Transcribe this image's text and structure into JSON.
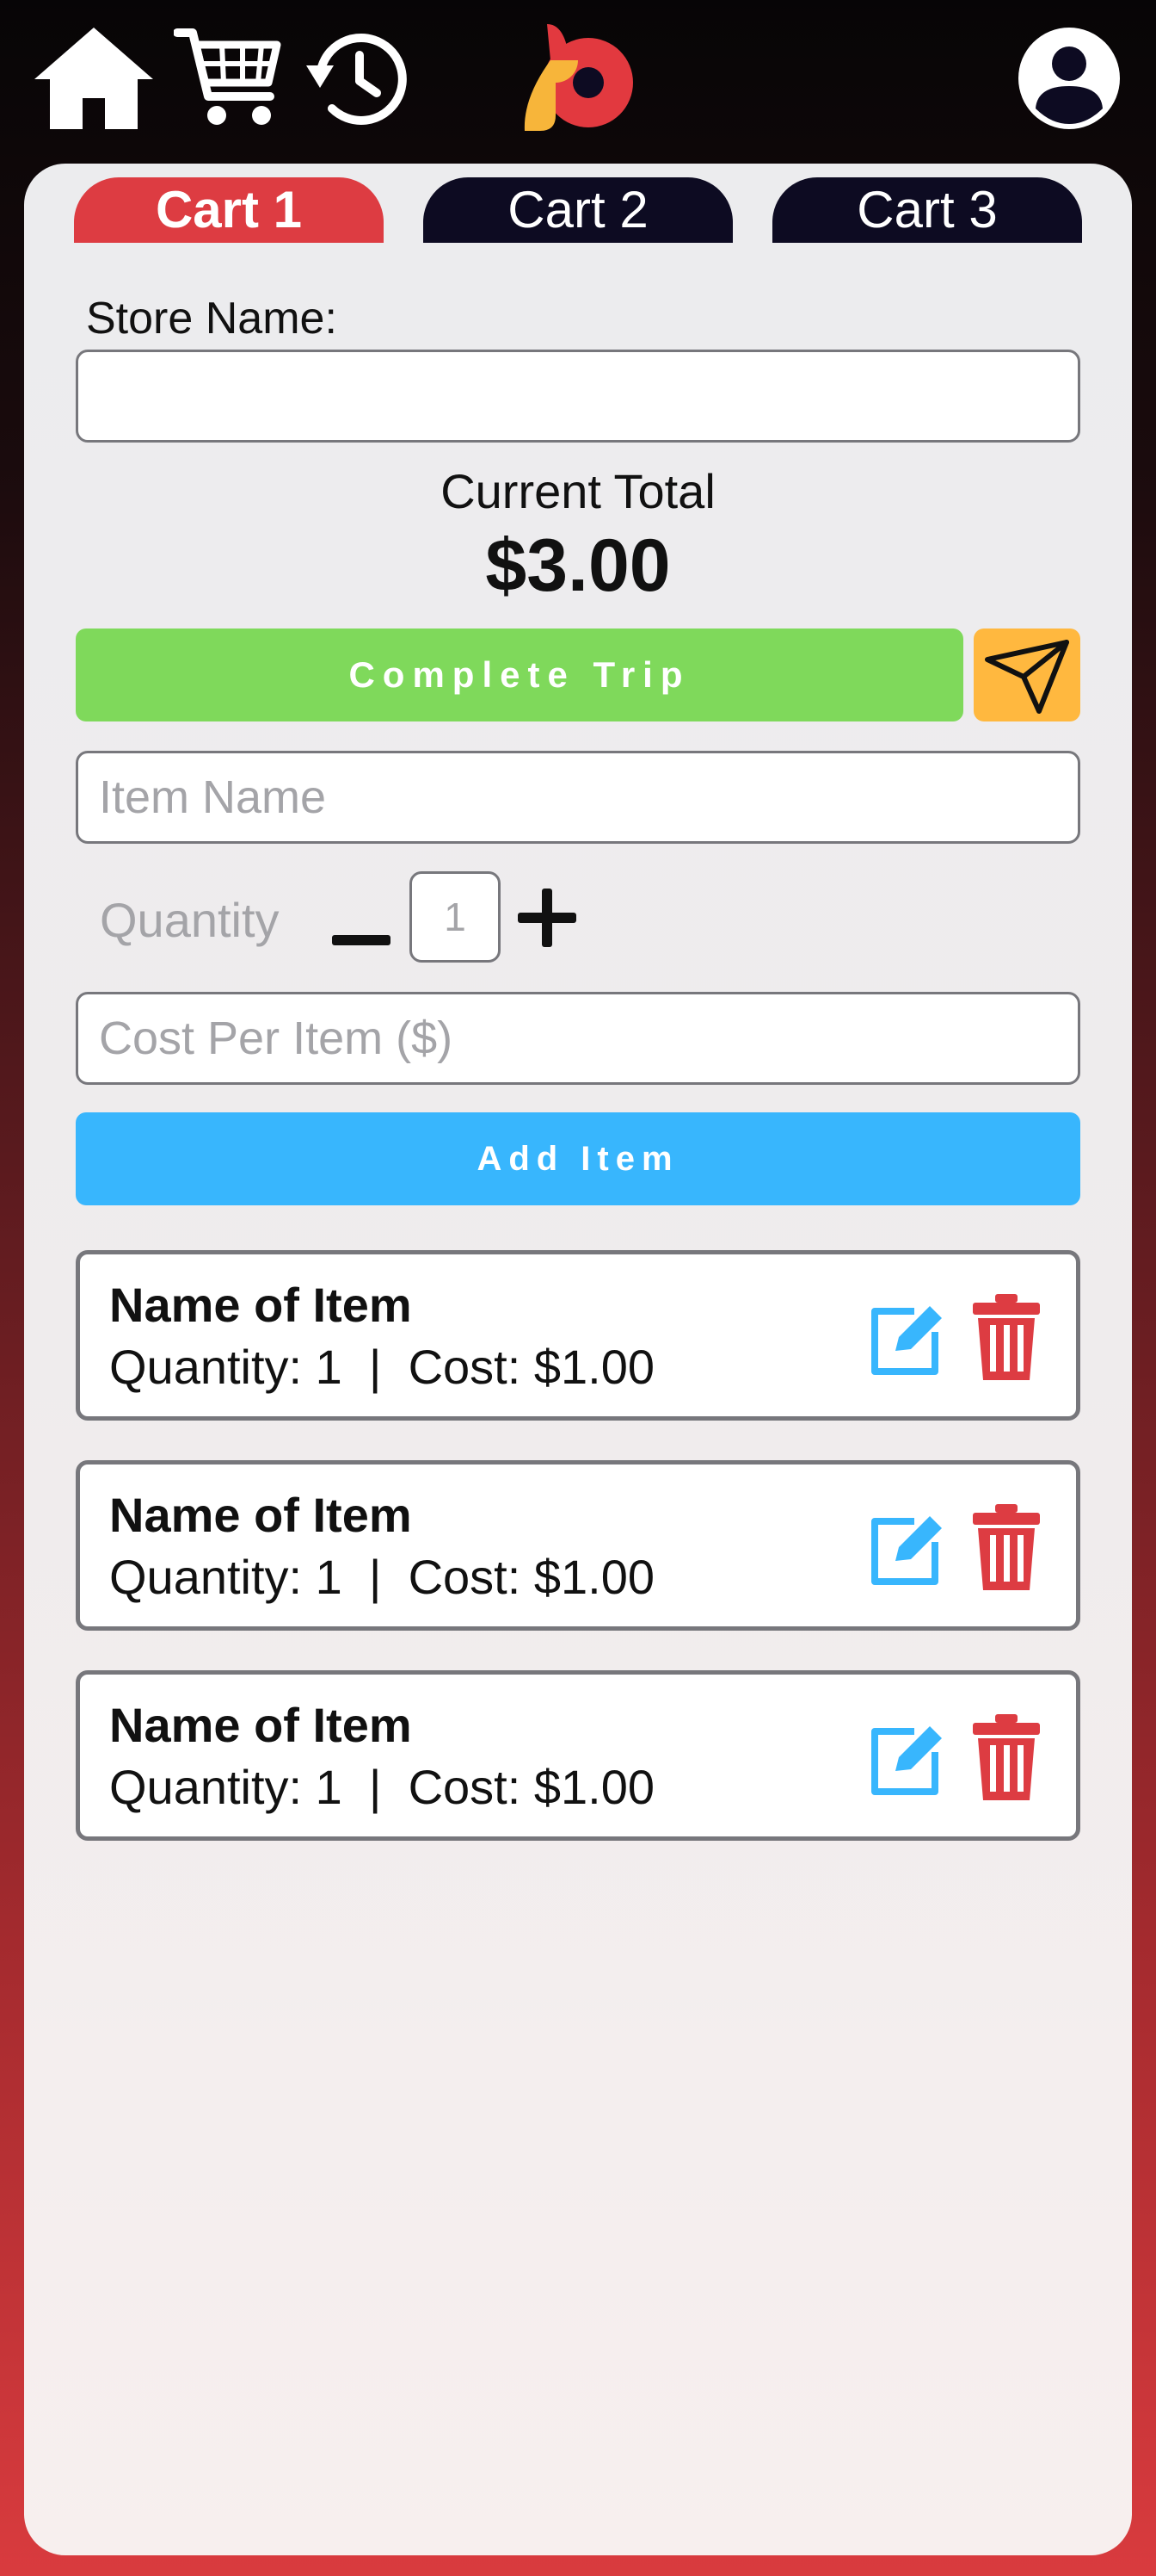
{
  "header": {
    "home_icon": "home-icon",
    "cart_icon": "shopping-cart-icon",
    "history_icon": "history-icon",
    "logo_icon": "app-logo",
    "profile_icon": "user-avatar-icon"
  },
  "tabs": [
    {
      "label": "Cart 1",
      "active": true
    },
    {
      "label": "Cart 2",
      "active": false
    },
    {
      "label": "Cart 3",
      "active": false
    }
  ],
  "store": {
    "label": "Store Name:",
    "value": ""
  },
  "total": {
    "label": "Current Total",
    "amount": "$3.00"
  },
  "actions": {
    "complete_trip": "Complete Trip",
    "send_icon": "send-icon",
    "add_item": "Add Item"
  },
  "form": {
    "item_name_placeholder": "Item Name",
    "quantity_label": "Quantity",
    "quantity_value": "1",
    "cost_placeholder": "Cost Per Item ($)"
  },
  "items": [
    {
      "name": "Name of Item",
      "meta": "Quantity: 1  |  Cost: $1.00"
    },
    {
      "name": "Name of Item",
      "meta": "Quantity: 1  |  Cost: $1.00"
    },
    {
      "name": "Name of Item",
      "meta": "Quantity: 1  |  Cost: $1.00"
    }
  ],
  "colors": {
    "active_tab": "#dd3c42",
    "inactive_tab": "#0d0b22",
    "complete_button": "#7fd95b",
    "send_button": "#ffb83f",
    "add_button": "#38b6fd",
    "edit_icon": "#38b6fd",
    "trash_icon": "#dd3c42"
  }
}
